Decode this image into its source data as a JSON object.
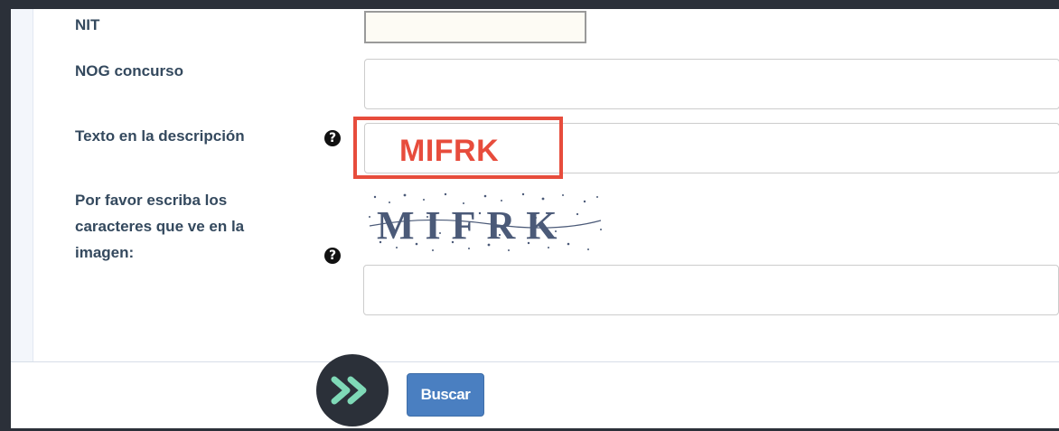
{
  "form": {
    "nit": {
      "label": "NIT",
      "value": ""
    },
    "nog": {
      "label": "NOG concurso",
      "value": ""
    },
    "descripcion": {
      "label": "Texto en la descripción",
      "value": "",
      "help_icon": "question-circle-icon"
    },
    "captcha": {
      "label": "Por favor escriba los\ncaracteres que ve en la\nimagen:",
      "image_text": "MIFRK",
      "value": "",
      "help_icon": "question-circle-icon"
    }
  },
  "annotation": {
    "text": "MIFRK",
    "color": "#e74c3c"
  },
  "actions": {
    "search_label": "Buscar",
    "badge_icon": "double-chevron-right-icon",
    "button_color": "#4a7fc1"
  }
}
